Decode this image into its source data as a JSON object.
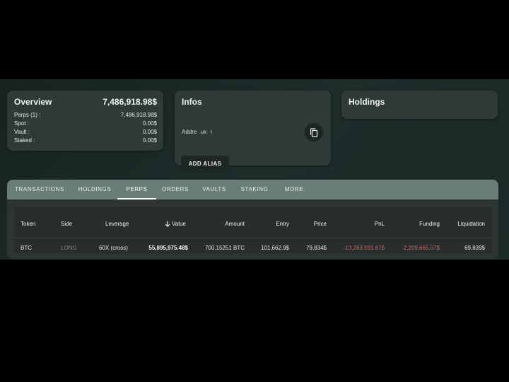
{
  "overview": {
    "title": "Overview",
    "total": "7,486,918.98$",
    "rows": [
      {
        "label": "Perps (1) :",
        "value": "7,486,918.98$"
      },
      {
        "label": "Spot :",
        "value": "0.00$"
      },
      {
        "label": "Vault :",
        "value": "0.00$"
      },
      {
        "label": "Staked :",
        "value": "0.00$"
      }
    ]
  },
  "infos": {
    "title": "Infos",
    "address": "Addre   ux   r",
    "add_alias": "ADD ALIAS",
    "copy_icon": "copy-icon"
  },
  "holdings": {
    "title": "Holdings"
  },
  "tabs": [
    "TRANSACTIONS",
    "HOLDINGS",
    "PERPS",
    "ORDERS",
    "VAULTS",
    "STAKING",
    "MORE"
  ],
  "active_tab": "PERPS",
  "table": {
    "columns": [
      "Token",
      "Side",
      "Leverage",
      "Value",
      "Amount",
      "Entry",
      "Price",
      "PnL",
      "Funding",
      "Liquidation"
    ],
    "sort_icon": "arrow-down-icon",
    "rows": [
      {
        "token": "BTC",
        "side": "LONG",
        "leverage": "60X (cross)",
        "value": "55,895,975.48$",
        "amount": "700.15251 BTC",
        "entry": "101,662.9$",
        "price": "79,834$",
        "pnl": "-13,283,591.67$",
        "funding": "-2,209,665.07$",
        "liquidation": "69,839$"
      }
    ]
  },
  "colors": {
    "background": "#1c2d2a",
    "card": "#2f3a38",
    "tabbar": "#6a7e79",
    "negative": "#c86a6a",
    "side_long": "#7d8886"
  }
}
